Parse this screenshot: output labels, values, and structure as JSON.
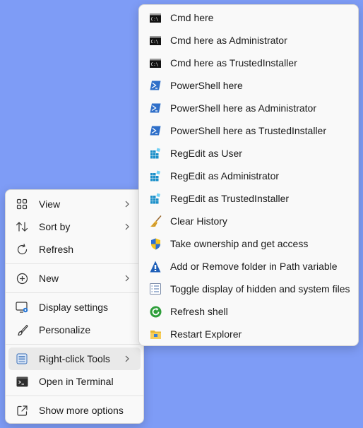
{
  "main_menu": {
    "items": [
      {
        "label": "View",
        "icon": "view-grid-icon"
      },
      {
        "label": "Sort by",
        "icon": "sort-arrows-icon"
      },
      {
        "label": "Refresh",
        "icon": "refresh-icon"
      },
      {
        "label": "New",
        "icon": "plus-circle-icon"
      },
      {
        "label": "Display settings",
        "icon": "display-icon"
      },
      {
        "label": "Personalize",
        "icon": "brush-icon"
      },
      {
        "label": "Right-click Tools",
        "icon": "tools-list-icon"
      },
      {
        "label": "Open in Terminal",
        "icon": "terminal-icon"
      },
      {
        "label": "Show more options",
        "icon": "share-box-icon"
      }
    ]
  },
  "submenu": {
    "items": [
      {
        "label": "Cmd here",
        "icon": "cmd-icon"
      },
      {
        "label": "Cmd here as Administrator",
        "icon": "cmd-icon"
      },
      {
        "label": "Cmd here as TrustedInstaller",
        "icon": "cmd-icon"
      },
      {
        "label": "PowerShell here",
        "icon": "powershell-icon"
      },
      {
        "label": "PowerShell here as Administrator",
        "icon": "powershell-icon"
      },
      {
        "label": "PowerShell here as TrustedInstaller",
        "icon": "powershell-icon"
      },
      {
        "label": "RegEdit as User",
        "icon": "regedit-icon"
      },
      {
        "label": "RegEdit as Administrator",
        "icon": "regedit-icon"
      },
      {
        "label": "RegEdit as TrustedInstaller",
        "icon": "regedit-icon"
      },
      {
        "label": "Clear History",
        "icon": "broom-icon"
      },
      {
        "label": "Take ownership and get access",
        "icon": "uac-shield-icon"
      },
      {
        "label": "Add or Remove folder in Path variable",
        "icon": "path-triangle-icon"
      },
      {
        "label": "Toggle display of hidden and system files",
        "icon": "checklist-icon"
      },
      {
        "label": "Refresh shell",
        "icon": "refresh-shell-icon"
      },
      {
        "label": "Restart Explorer",
        "icon": "explorer-icon"
      }
    ]
  },
  "colors": {
    "desktop_background": "#7e9cf6",
    "menu_background": "#f9f9f9",
    "active_item": "#e9e9e9"
  }
}
